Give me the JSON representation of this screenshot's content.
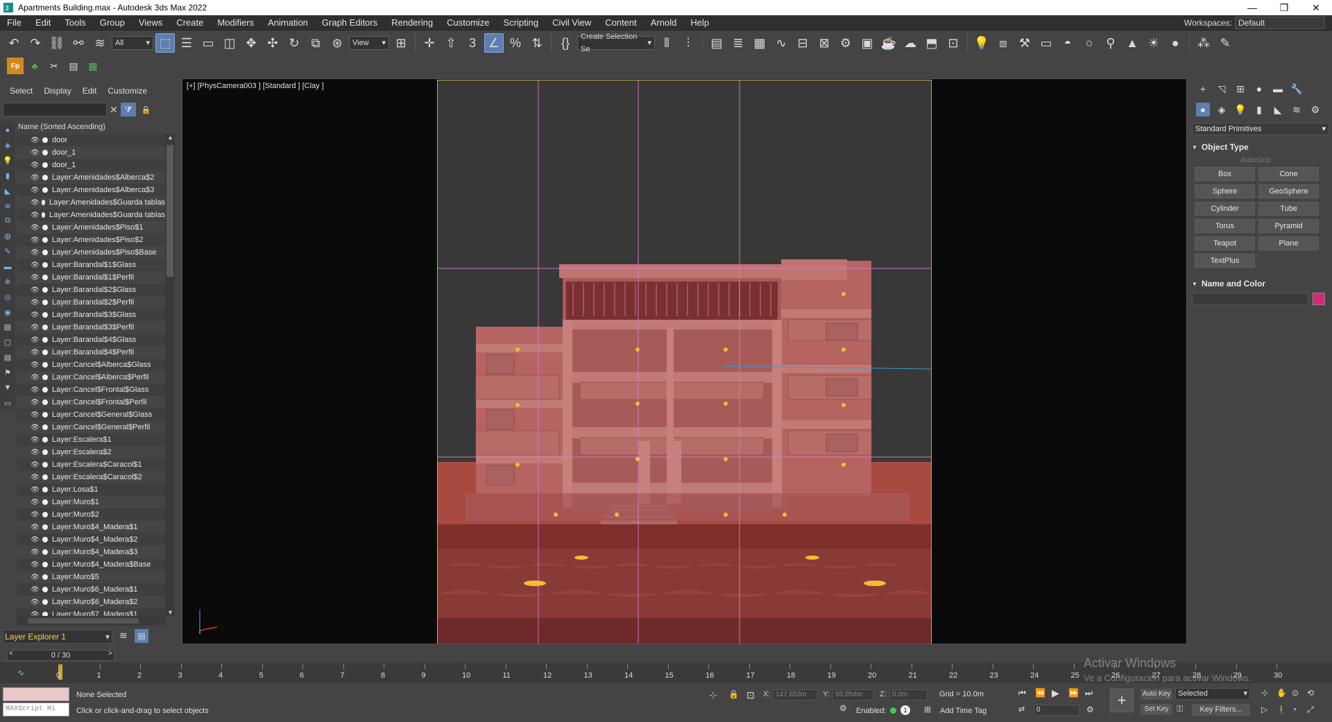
{
  "window": {
    "title": "Apartments Building.max - Autodesk 3ds Max 2022",
    "min_label": "—",
    "max_label": "❐",
    "close_label": "✕"
  },
  "menu": [
    "File",
    "Edit",
    "Tools",
    "Group",
    "Views",
    "Create",
    "Modifiers",
    "Animation",
    "Graph Editors",
    "Rendering",
    "Customize",
    "Scripting",
    "Civil View",
    "Content",
    "Arnold",
    "Help"
  ],
  "workspace": {
    "label": "Workspaces:",
    "value": "Default"
  },
  "toolbar": {
    "filter_value": "All",
    "view_value": "View",
    "selection_set_value": "Create Selection Se"
  },
  "explorer": {
    "tabs": [
      "Select",
      "Display",
      "Edit",
      "Customize"
    ],
    "column_header": "Name (Sorted Ascending)",
    "items": [
      "door",
      "door_1",
      "door_1",
      "Layer:Amenidades$Alberca$2",
      "Layer:Amenidades$Alberca$3",
      "Layer:Amenidades$Guarda tablas",
      "Layer:Amenidades$Guarda tablas",
      "Layer:Amenidades$Piso$1",
      "Layer:Amenidades$Piso$2",
      "Layer:Amenidades$Piso$Base",
      "Layer:Barandal$1$Glass",
      "Layer:Barandal$1$Perfil",
      "Layer:Barandal$2$Glass",
      "Layer:Barandal$2$Perfil",
      "Layer:Barandal$3$Glass",
      "Layer:Barandal$3$Perfil",
      "Layer:Barandal$4$Glass",
      "Layer:Barandal$4$Perfil",
      "Layer:Cancel$Alberca$Glass",
      "Layer:Cancel$Alberca$Perfil",
      "Layer:Cancel$Frontal$Glass",
      "Layer:Cancel$Frontal$Perfil",
      "Layer:Cancel$General$Glass",
      "Layer:Cancel$General$Perfil",
      "Layer:Escalera$1",
      "Layer:Escalera$2",
      "Layer:Escalera$Caracol$1",
      "Layer:Escalera$Caracol$2",
      "Layer:Losa$1",
      "Layer:Muro$1",
      "Layer:Muro$2",
      "Layer:Muro$4_Madera$1",
      "Layer:Muro$4_Madera$2",
      "Layer:Muro$4_Madera$3",
      "Layer:Muro$4_Madera$Base",
      "Layer:Muro$5",
      "Layer:Muro$6_Madera$1",
      "Layer:Muro$6_Madera$2",
      "Layer:Muro$7_Madera$1"
    ],
    "layer_explorer": "Layer Explorer 1",
    "frame_counter": "0 / 30"
  },
  "viewport": {
    "label": "[+] [PhysCamera003 ] [Standard ] [Clay ]"
  },
  "command_panel": {
    "category": "Standard Primitives",
    "object_type_title": "Object Type",
    "autogrid": "AutoGrid",
    "buttons": [
      "Box",
      "Cone",
      "Sphere",
      "GeoSphere",
      "Cylinder",
      "Tube",
      "Torus",
      "Pyramid",
      "Teapot",
      "Plane",
      "TextPlus"
    ],
    "name_color_title": "Name and Color",
    "name_color_swatch": "#d6287a"
  },
  "timeline": {
    "ticks": [
      "0",
      "1",
      "2",
      "3",
      "4",
      "5",
      "6",
      "7",
      "8",
      "9",
      "10",
      "11",
      "12",
      "13",
      "14",
      "15",
      "16",
      "17",
      "18",
      "19",
      "20",
      "21",
      "22",
      "23",
      "24",
      "25",
      "26",
      "27",
      "28",
      "29",
      "30"
    ]
  },
  "status": {
    "maxscript": "MAXScript Mi",
    "selection": "None Selected",
    "prompt": "Click or click-and-drag to select objects",
    "x_label": "X:",
    "x_value": "147.653m",
    "y_label": "Y:",
    "y_value": "65.054m",
    "z_label": "Z:",
    "z_value": "0.0m",
    "grid": "Grid = 10.0m",
    "enabled": "Enabled:",
    "add_time_tag": "Add Time Tag",
    "auto_key": "Auto Key",
    "selected": "Selected",
    "set_key": "Set Key",
    "key_filters": "Key Filters...",
    "frame_value": "0"
  },
  "watermark": {
    "line1": "Activar Windows",
    "line2": "Ve a Configuración para activar Windows."
  },
  "colors": {
    "building": "#b46464",
    "ground": "#8a3a36",
    "accent": "#5c7fb0"
  }
}
